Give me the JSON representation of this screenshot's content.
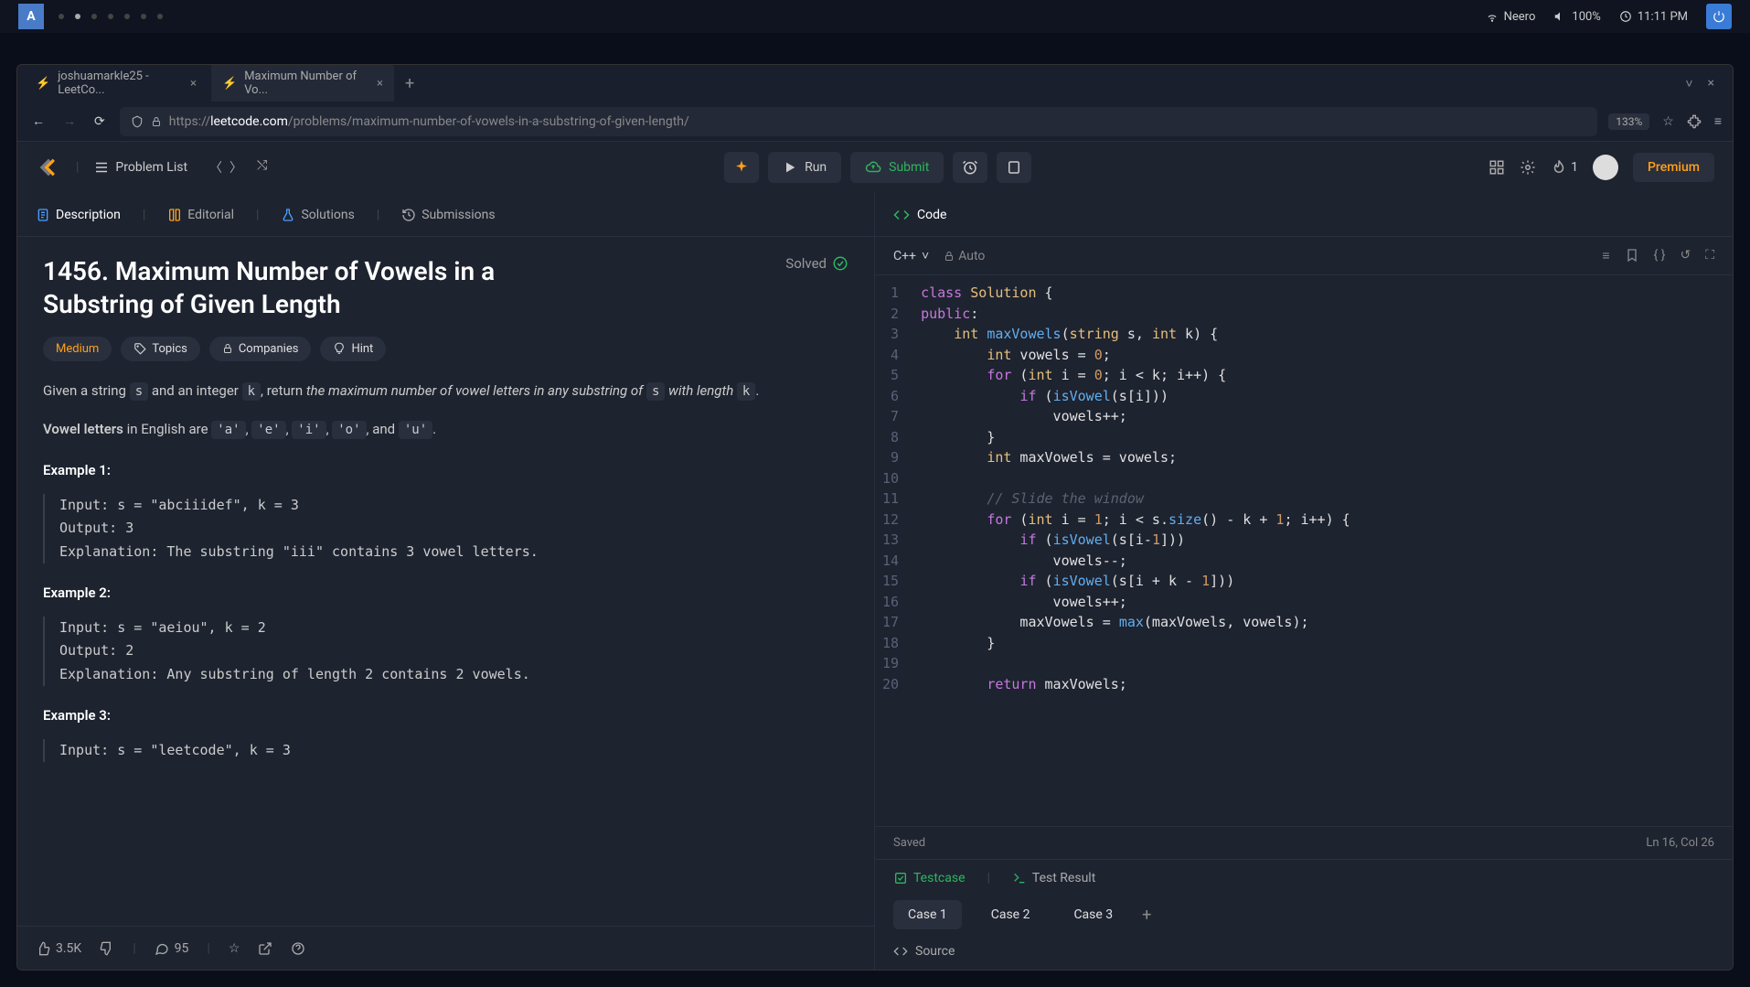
{
  "system": {
    "user": "Neero",
    "volume": "100%",
    "time": "11:11 PM"
  },
  "tabs": [
    {
      "label": "joshuamarkle25 - LeetCo..."
    },
    {
      "label": "Maximum Number of Vo..."
    }
  ],
  "url": {
    "prefix": "https://",
    "host": "leetcode.com",
    "path": "/problems/maximum-number-of-vowels-in-a-substring-of-given-length/"
  },
  "zoom": "133%",
  "lc_nav": {
    "problem_list": "Problem List"
  },
  "actions": {
    "run": "Run",
    "submit": "Submit"
  },
  "streak": "1",
  "premium": "Premium",
  "left_tabs": {
    "description": "Description",
    "editorial": "Editorial",
    "solutions": "Solutions",
    "submissions": "Submissions"
  },
  "problem": {
    "title": "1456. Maximum Number of Vowels in a Substring of Given Length",
    "solved": "Solved",
    "difficulty": "Medium",
    "tags": {
      "topics": "Topics",
      "companies": "Companies",
      "hint": "Hint"
    },
    "desc_p1a": "Given a string ",
    "desc_p1b": " and an integer ",
    "desc_p1c": ", return ",
    "desc_p1d": "the maximum number of vowel letters in any substring of ",
    "desc_p1e": " with length ",
    "desc_p2a": "Vowel letters",
    "desc_p2b": " in English are ",
    "desc_p2c": ", and ",
    "vowels": [
      "'a'",
      "'e'",
      "'i'",
      "'o'",
      "'u'"
    ],
    "examples": [
      {
        "title": "Example 1:",
        "input": "Input: s = \"abciiidef\", k = 3",
        "output": "Output: 3",
        "explanation": "Explanation: The substring \"iii\" contains 3 vowel letters."
      },
      {
        "title": "Example 2:",
        "input": "Input: s = \"aeiou\", k = 2",
        "output": "Output: 2",
        "explanation": "Explanation: Any substring of length 2 contains 2 vowels."
      },
      {
        "title": "Example 3:",
        "input": "Input: s = \"leetcode\", k = 3",
        "output": "",
        "explanation": ""
      }
    ]
  },
  "footer": {
    "likes": "3.5K",
    "comments": "95"
  },
  "code": {
    "header": "Code",
    "language": "C++",
    "auto": "Auto",
    "lines": [
      {
        "n": 1,
        "html": "<span class='kw'>class</span> <span class='type'>Solution</span> {"
      },
      {
        "n": 2,
        "html": "<span class='kw'>public</span>:"
      },
      {
        "n": 3,
        "html": "    <span class='type'>int</span> <span class='fn'>maxVowels</span>(<span class='type'>string</span> s, <span class='type'>int</span> k) {"
      },
      {
        "n": 4,
        "html": "        <span class='type'>int</span> vowels = <span class='num'>0</span>;"
      },
      {
        "n": 5,
        "html": "        <span class='kw'>for</span> (<span class='type'>int</span> i = <span class='num'>0</span>; i &lt; k; i++) {"
      },
      {
        "n": 6,
        "html": "            <span class='kw'>if</span> (<span class='fn'>isVowel</span>(s[i]))"
      },
      {
        "n": 7,
        "html": "                vowels++;"
      },
      {
        "n": 8,
        "html": "        }"
      },
      {
        "n": 9,
        "html": "        <span class='type'>int</span> maxVowels = vowels;"
      },
      {
        "n": 10,
        "html": ""
      },
      {
        "n": 11,
        "html": "        <span class='com'>// Slide the window</span>"
      },
      {
        "n": 12,
        "html": "        <span class='kw'>for</span> (<span class='type'>int</span> i = <span class='num'>1</span>; i &lt; s.<span class='fn'>size</span>() - k + <span class='num'>1</span>; i++) {"
      },
      {
        "n": 13,
        "html": "            <span class='kw'>if</span> (<span class='fn'>isVowel</span>(s[i-<span class='num'>1</span>]))"
      },
      {
        "n": 14,
        "html": "                vowels--;"
      },
      {
        "n": 15,
        "html": "            <span class='kw'>if</span> (<span class='fn'>isVowel</span>(s[i + k - <span class='num'>1</span>]))"
      },
      {
        "n": 16,
        "html": "                vowels++;"
      },
      {
        "n": 17,
        "html": "            maxVowels = <span class='fn'>max</span>(maxVowels, vowels);"
      },
      {
        "n": 18,
        "html": "        }"
      },
      {
        "n": 19,
        "html": ""
      },
      {
        "n": 20,
        "html": "        <span class='kw'>return</span> maxVowels;"
      }
    ],
    "saved": "Saved",
    "cursor": "Ln 16, Col 26"
  },
  "test": {
    "testcase": "Testcase",
    "result": "Test Result",
    "cases": [
      "Case 1",
      "Case 2",
      "Case 3"
    ],
    "source": "Source"
  }
}
